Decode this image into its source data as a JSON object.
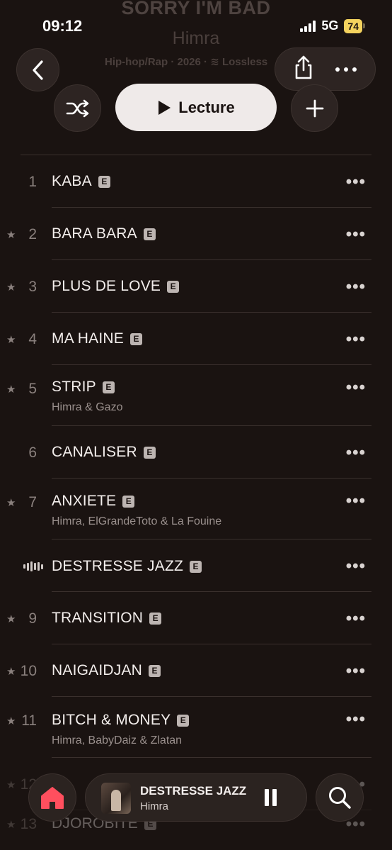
{
  "status_bar": {
    "time": "09:12",
    "network": "5G",
    "battery": "74"
  },
  "album": {
    "title": "SORRY I'M BAD",
    "artist": "Himra",
    "meta": "Hip-hop/Rap · 2026 · ",
    "lossless": "Lossless"
  },
  "controls": {
    "play_label": "Lecture"
  },
  "tracks": [
    {
      "number": "1",
      "title": "KABA",
      "explicit": "E",
      "starred": false,
      "artists": ""
    },
    {
      "number": "2",
      "title": "BARA BARA",
      "explicit": "E",
      "starred": true,
      "artists": ""
    },
    {
      "number": "3",
      "title": "PLUS DE LOVE",
      "explicit": "E",
      "starred": true,
      "artists": ""
    },
    {
      "number": "4",
      "title": "MA HAINE",
      "explicit": "E",
      "starred": true,
      "artists": ""
    },
    {
      "number": "5",
      "title": "STRIP",
      "explicit": "E",
      "starred": true,
      "artists": "Himra & Gazo"
    },
    {
      "number": "6",
      "title": "CANALISER",
      "explicit": "E",
      "starred": false,
      "artists": ""
    },
    {
      "number": "7",
      "title": "ANXIETE",
      "explicit": "E",
      "starred": true,
      "artists": "Himra, ElGrandeToto & La Fouine"
    },
    {
      "number": "",
      "title": "DESTRESSE JAZZ",
      "explicit": "E",
      "starred": false,
      "playing": true,
      "artists": ""
    },
    {
      "number": "9",
      "title": "TRANSITION",
      "explicit": "E",
      "starred": true,
      "artists": ""
    },
    {
      "number": "10",
      "title": "NAIGAIDJAN",
      "explicit": "E",
      "starred": true,
      "artists": ""
    },
    {
      "number": "11",
      "title": "BITCH & MONEY",
      "explicit": "E",
      "starred": true,
      "artists": "Himra, BabyDaiz & Zlatan"
    },
    {
      "number": "12",
      "title": "",
      "explicit": "",
      "starred": true,
      "artists": ""
    },
    {
      "number": "13",
      "title": "DJOROBITE",
      "explicit": "E",
      "starred": true,
      "artists": ""
    }
  ],
  "more_label": "•••",
  "mini_player": {
    "title": "DESTRESSE JAZZ",
    "artist": "Himra"
  },
  "colors": {
    "background": "#1a1311",
    "accent": "#ff4f5e",
    "explicit_badge": "#bdb5b2"
  }
}
